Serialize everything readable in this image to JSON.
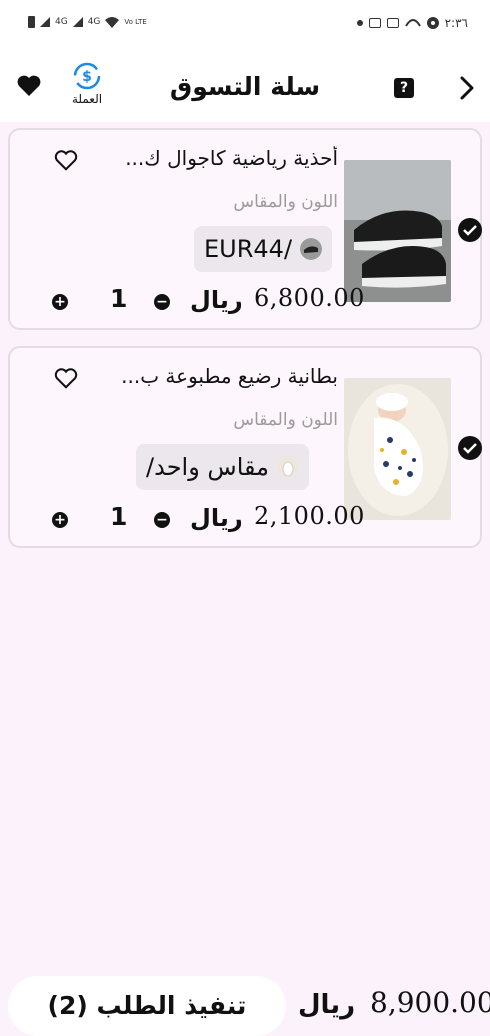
{
  "status_bar": {
    "time": "٢:٣٦",
    "net1": "4G",
    "net2": "4G",
    "volte": "Vo LTE"
  },
  "header": {
    "title": "سلة التسوق",
    "currency_label": "العملة",
    "help_icon": "?"
  },
  "cart": {
    "items": [
      {
        "name": "أحذية رياضية كاجوال ك...",
        "color_size_label": "اللون والمقاس",
        "variant": "EUR44/",
        "price": "6,800.00",
        "currency": "ريال",
        "quantity": "1",
        "selected": true
      },
      {
        "name": "بطانية رضيع مطبوعة ب...",
        "color_size_label": "اللون والمقاس",
        "variant": "/مقاس واحد",
        "price": "2,100.00",
        "currency": "ريال",
        "quantity": "1",
        "selected": true
      }
    ]
  },
  "footer": {
    "checkout_label": "تنفيذ الطلب (2)",
    "total_currency": "ريال",
    "total": "8,900.00"
  },
  "colors": {
    "background": "#fcf2fb",
    "card_border": "#e4dbe3",
    "accent": "#1e88e5",
    "muted_text": "#9b9b9b"
  },
  "icons": [
    "back-chevron-icon",
    "help-icon",
    "currency-exchange-icon",
    "heart-filled-icon",
    "heart-outline-icon",
    "check-circle-icon",
    "plus-icon",
    "minus-icon"
  ]
}
